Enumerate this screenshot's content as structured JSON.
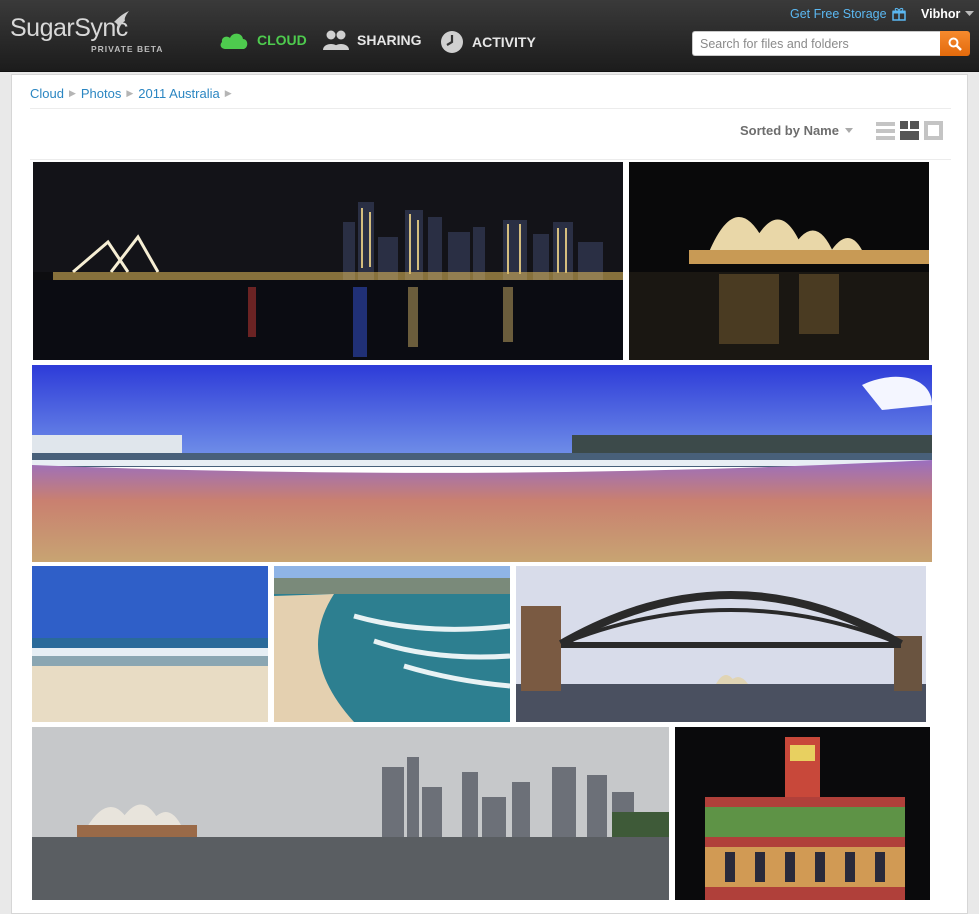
{
  "header": {
    "logo_text": "SugarSync",
    "logo_sub": "PRIVATE BETA",
    "nav": [
      {
        "label": "CLOUD",
        "icon": "cloud-icon",
        "active": true
      },
      {
        "label": "SHARING",
        "icon": "people-icon",
        "active": false
      },
      {
        "label": "ACTIVITY",
        "icon": "clock-icon",
        "active": false
      }
    ],
    "free_storage": "Get Free Storage",
    "user": "Vibhor",
    "search_placeholder": "Search for files and folders"
  },
  "breadcrumb": [
    "Cloud",
    "Photos",
    "2011 Australia"
  ],
  "toolbar": {
    "sort_label": "Sorted by Name",
    "views": [
      "list-view-icon",
      "grid-view-icon",
      "single-view-icon"
    ]
  },
  "colors": {
    "accent_green": "#4ecb4e",
    "link_blue": "#2b86c2",
    "search_orange": "#f07b1c"
  },
  "photos": [
    {
      "subject": "sydney-skyline-night"
    },
    {
      "subject": "opera-house-night"
    },
    {
      "subject": "bondi-beach-panorama"
    },
    {
      "subject": "beach-waves"
    },
    {
      "subject": "bondi-beach-aerial"
    },
    {
      "subject": "harbour-bridge"
    },
    {
      "subject": "opera-house-city-day"
    },
    {
      "subject": "illuminated-building"
    }
  ]
}
